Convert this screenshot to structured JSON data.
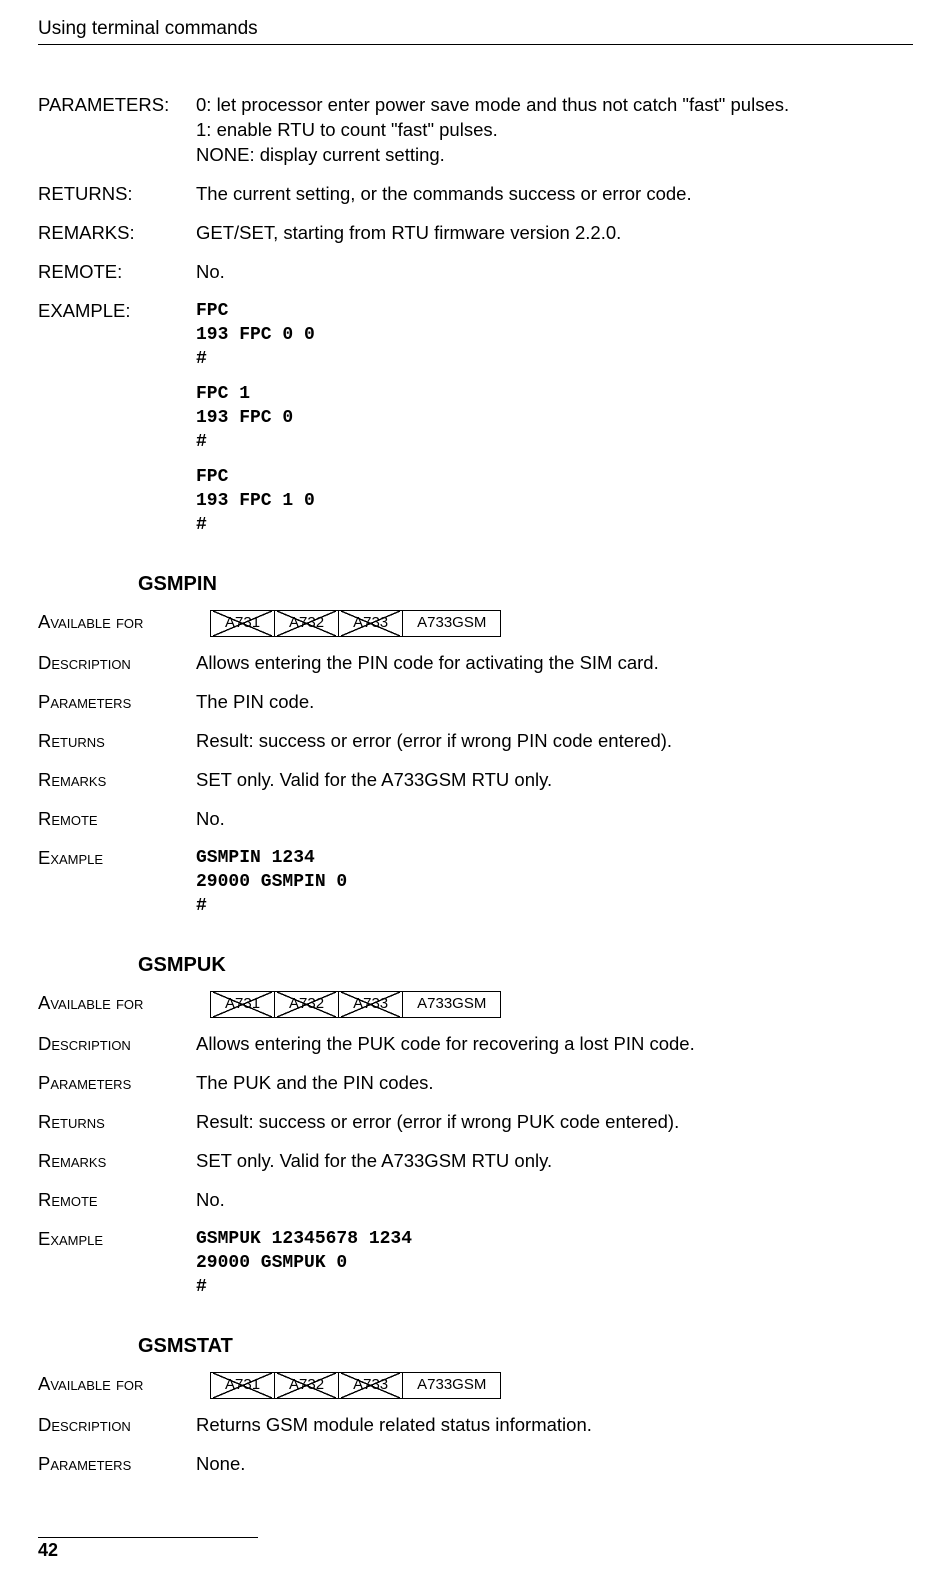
{
  "header": {
    "title": "Using terminal commands"
  },
  "labels": {
    "parameters_uc": "PARAMETERS:",
    "returns_uc": "RETURNS:",
    "remarks_uc": "REMARKS:",
    "remote_uc": "REMOTE:",
    "example_uc": "EXAMPLE:",
    "available_sc": "Available for",
    "description_sc": "Description",
    "parameters_sc": "Parameters",
    "returns_sc": "Returns",
    "remarks_sc": "Remarks",
    "remote_sc": "Remote",
    "example_sc": "Example"
  },
  "fpc": {
    "parameters": "0: let processor enter power save mode and thus not catch \"fast\" pulses.\n1: enable RTU to count \"fast\" pulses.\nNONE: display current setting.",
    "returns": "The current setting, or the commands success or error code.",
    "remarks": "GET/SET, starting from RTU firmware version 2.2.0.",
    "remote": "No.",
    "example_blocks": [
      "FPC\n193 FPC 0 0\n#",
      "FPC 1\n193 FPC 0\n#",
      "FPC\n193 FPC 1 0\n#"
    ]
  },
  "models": {
    "a731": "A731",
    "a732": "A732",
    "a733": "A733",
    "a733gsm": "A733GSM"
  },
  "gsmpin": {
    "heading": "GSMPIN",
    "description": "Allows entering the PIN code for activating the SIM card.",
    "parameters": "The PIN code.",
    "returns": "Result: success or error (error if wrong PIN code entered).",
    "remarks": "SET only. Valid for the A733GSM RTU only.",
    "remote": "No.",
    "example": "GSMPIN 1234\n29000 GSMPIN 0\n#"
  },
  "gsmpuk": {
    "heading": "GSMPUK",
    "description": "Allows entering the PUK code for recovering a lost PIN code.",
    "parameters": "The PUK and the PIN codes.",
    "returns": "Result: success or error (error if wrong PUK code entered).",
    "remarks": "SET only. Valid for the A733GSM RTU only.",
    "remote": "No.",
    "example": "GSMPUK 12345678 1234\n29000 GSMPUK 0\n#"
  },
  "gsmstat": {
    "heading": "GSMSTAT",
    "description": "Returns GSM module related status information.",
    "parameters": "None."
  },
  "page_number": "42"
}
